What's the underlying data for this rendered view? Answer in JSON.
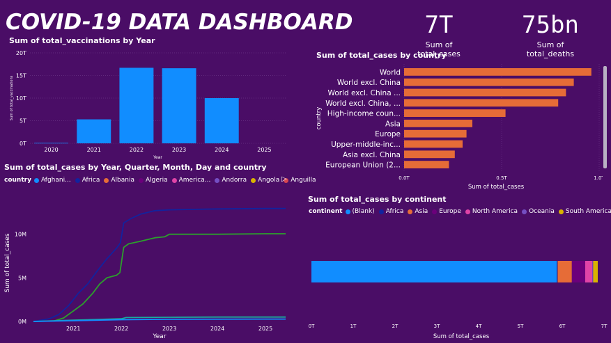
{
  "dashboard": {
    "title": "COVID-19 DATA DASHBOARD"
  },
  "kpis": [
    {
      "value": "7T",
      "label": "Sum of total_cases"
    },
    {
      "value": "75bn",
      "label": "Sum of total_deaths"
    }
  ],
  "colors": {
    "background": "#4a0d66",
    "blue": "#118dff",
    "orange": "#e66c37",
    "dark_blue": "#12239e",
    "green": "#2ca02c",
    "teal": "#1aab9b",
    "gridline": "#6a3585"
  },
  "chart_data": [
    {
      "id": "vacc",
      "type": "bar",
      "title": "Sum of total_vaccinations by Year",
      "xlabel": "Year",
      "ylabel": "Sum of total_vaccinations",
      "categories": [
        "2020",
        "2021",
        "2022",
        "2023",
        "2024",
        "2025"
      ],
      "values": [
        0.1,
        5.3,
        16.7,
        16.6,
        10.0,
        0
      ],
      "ylim": [
        0,
        20
      ],
      "yticks": [
        "0T",
        "5T",
        "10T",
        "15T",
        "20T"
      ],
      "grid": true
    },
    {
      "id": "country",
      "type": "bar",
      "orientation": "horizontal",
      "title": "Sum of total_cases by country",
      "xlabel": "Sum of total_cases",
      "ylabel": "country",
      "categories": [
        "World",
        "World excl. China",
        "World excl. China ...",
        "World excl. China, ...",
        "High-income coun...",
        "Asia",
        "Europe",
        "Upper-middle-inc...",
        "Asia excl. China",
        "European Union (2..."
      ],
      "values": [
        0.96,
        0.87,
        0.83,
        0.79,
        0.52,
        0.35,
        0.32,
        0.3,
        0.26,
        0.23
      ],
      "xlim": [
        0,
        1.0
      ],
      "xticks": [
        "0.0T",
        "0.5T",
        "1.0T"
      ],
      "grid": true
    },
    {
      "id": "timeline",
      "type": "line",
      "title": "Sum of total_cases by Year, Quarter, Month, Day and country",
      "xlabel": "Year",
      "ylabel": "Sum of total_cases",
      "xticks": [
        "2021",
        "2022",
        "2023",
        "2024",
        "2025"
      ],
      "yticks": [
        "0M",
        "5M",
        "10M"
      ],
      "ylim": [
        0,
        15
      ],
      "legend_title": "country",
      "legend": [
        {
          "name": "Afghani...",
          "color": "#118dff"
        },
        {
          "name": "Africa",
          "color": "#12239e"
        },
        {
          "name": "Albania",
          "color": "#e66c37"
        },
        {
          "name": "Algeria",
          "color": "#6b007b"
        },
        {
          "name": "America...",
          "color": "#e044a7"
        },
        {
          "name": "Andorra",
          "color": "#744ec2"
        },
        {
          "name": "Angola",
          "color": "#d9b300"
        },
        {
          "name": "Anguilla",
          "color": "#d64550"
        }
      ],
      "series": [
        {
          "color": "#12239e",
          "x": [
            2020.17,
            2020.5,
            2020.7,
            2020.9,
            2021.1,
            2021.3,
            2021.5,
            2021.7,
            2021.9,
            2021.98,
            2022.05,
            2022.2,
            2022.4,
            2022.7,
            2023.0,
            2024.0,
            2025.0,
            2025.42
          ],
          "y": [
            0,
            0.3,
            0.8,
            1.8,
            3.2,
            4.3,
            5.8,
            7.2,
            8.4,
            9.0,
            11.3,
            11.8,
            12.3,
            12.7,
            12.8,
            12.9,
            12.95,
            12.95
          ]
        },
        {
          "color": "#2ca02c",
          "x": [
            2020.17,
            2020.6,
            2020.8,
            2021.0,
            2021.2,
            2021.4,
            2021.55,
            2021.7,
            2021.9,
            2021.97,
            2022.05,
            2022.15,
            2022.4,
            2022.7,
            2022.9,
            2023.0,
            2024.0,
            2025.0,
            2025.42
          ],
          "y": [
            0,
            0.05,
            0.4,
            1.2,
            2.0,
            3.2,
            4.3,
            5.0,
            5.3,
            5.6,
            8.5,
            8.9,
            9.2,
            9.6,
            9.7,
            10.0,
            10.0,
            10.05,
            10.05
          ]
        },
        {
          "color": "#1aab9b",
          "x": [
            2020.17,
            2021.0,
            2022.0,
            2022.1,
            2023.0,
            2024.0,
            2025.42
          ],
          "y": [
            0,
            0.15,
            0.3,
            0.45,
            0.48,
            0.5,
            0.5
          ]
        },
        {
          "color": "#118dff",
          "x": [
            2020.17,
            2021.0,
            2022.0,
            2023.0,
            2025.42
          ],
          "y": [
            0,
            0.08,
            0.2,
            0.25,
            0.27
          ]
        }
      ]
    },
    {
      "id": "continent",
      "type": "bar",
      "orientation": "horizontal",
      "stacked": true,
      "title": "Sum of total_cases by continent",
      "xlabel": "Sum of total_cases",
      "xlim": [
        0,
        7
      ],
      "xticks": [
        "0T",
        "1T",
        "2T",
        "3T",
        "4T",
        "5T",
        "6T",
        "7T"
      ],
      "legend_title": "continent",
      "series": [
        {
          "name": "(Blank)",
          "color": "#118dff",
          "value": 5.87
        },
        {
          "name": "Africa",
          "color": "#12239e",
          "value": 0.02
        },
        {
          "name": "Asia",
          "color": "#e66c37",
          "value": 0.34
        },
        {
          "name": "Europe",
          "color": "#6b007b",
          "value": 0.32
        },
        {
          "name": "North America",
          "color": "#e044a7",
          "value": 0.17
        },
        {
          "name": "Oceania",
          "color": "#744ec2",
          "value": 0.02
        },
        {
          "name": "South America",
          "color": "#d9b300",
          "value": 0.11
        }
      ]
    }
  ]
}
